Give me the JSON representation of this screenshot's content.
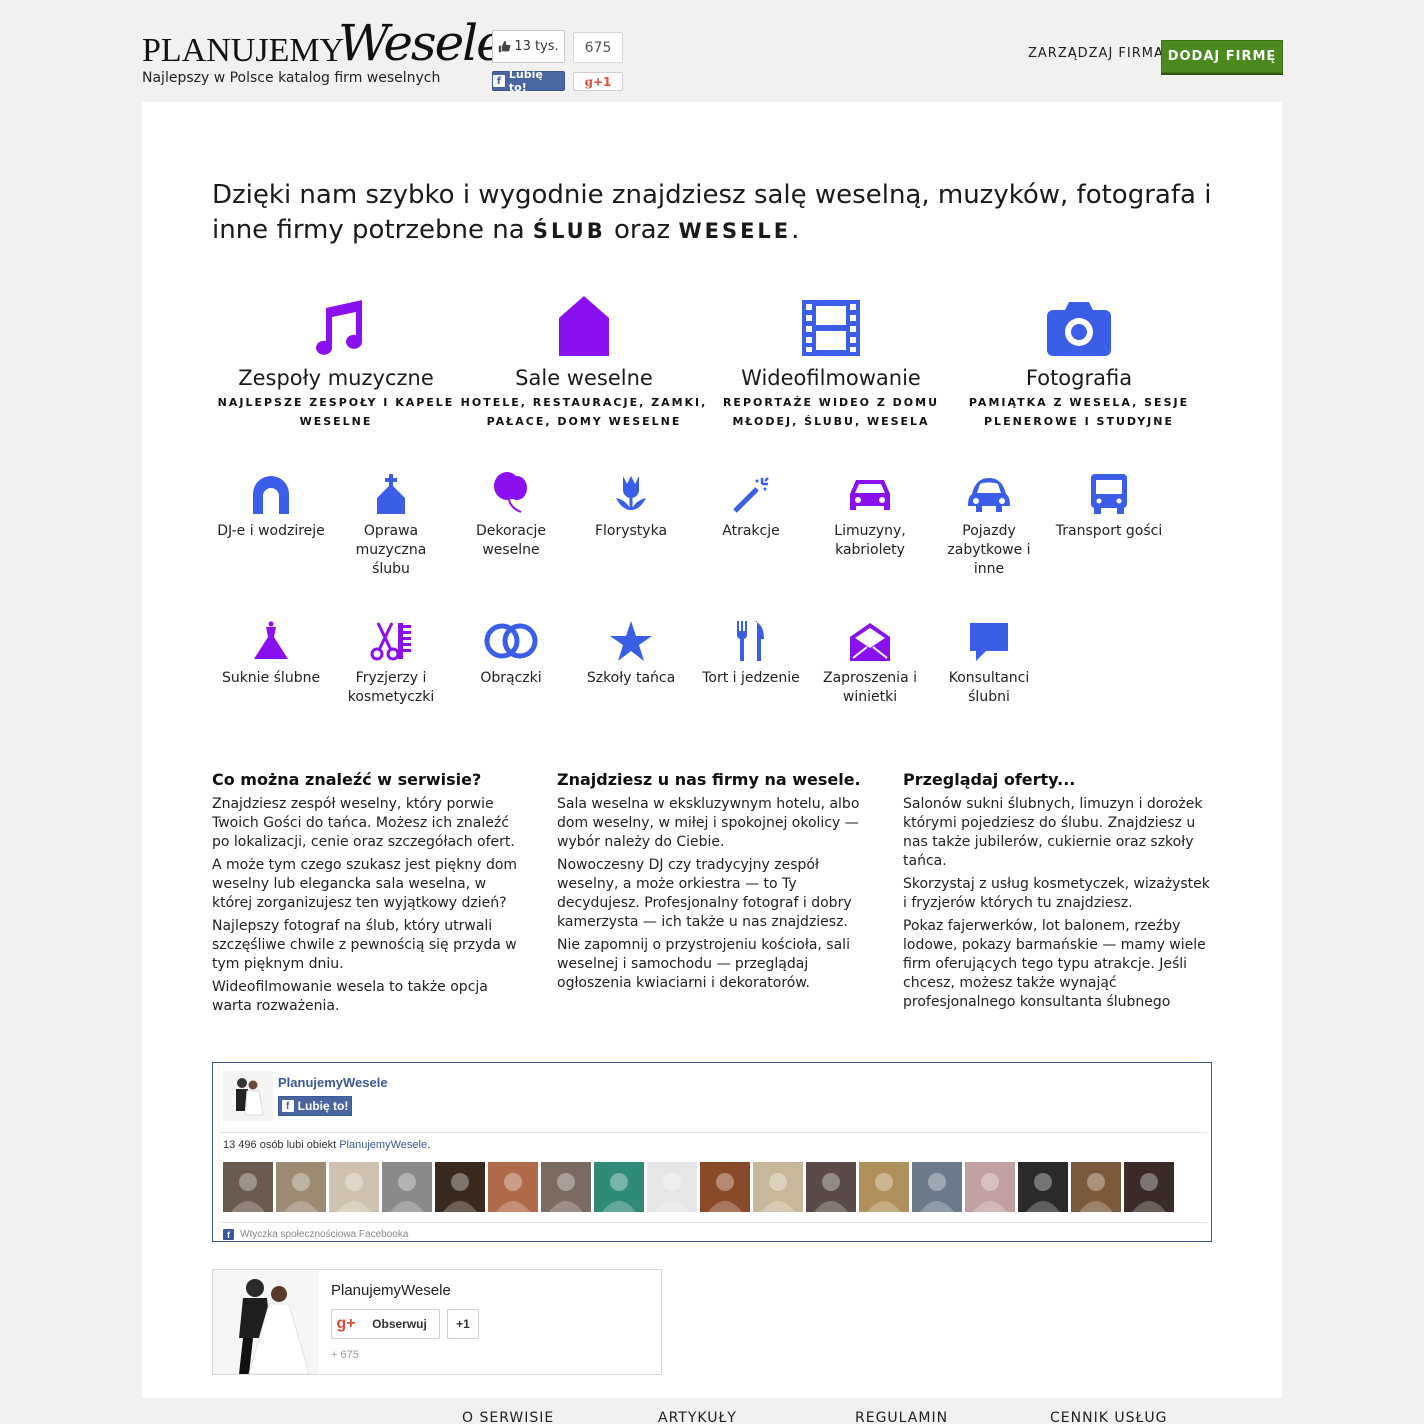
{
  "header": {
    "logo_part1": "PLANUJEMY",
    "logo_part2": "Wesele",
    "tagline": "Najlepszy w Polsce katalog firm weselnych",
    "fb_count": "13 tys.",
    "fb_like_label": "Lubię to!",
    "gplus_count": "675",
    "gplus_label": "+1",
    "manage_link": "ZARZĄDZAJ FIRMĄ",
    "add_button": "DODAJ FIRMĘ"
  },
  "intro": {
    "text_before": "Dzięki nam szybko i wygodnie znajdziesz salę weselną, muzyków, fotografa i inne firmy potrzebne na",
    "bold1": "ŚLUB",
    "middle": "oraz",
    "bold2": "WESELE",
    "end": "."
  },
  "big_categories": [
    {
      "title": "Zespoły muzyczne",
      "subtitle": "NAJLEPSZE ZESPOŁY I KAPELE WESELNE",
      "icon": "music-note-icon",
      "color": "#8b10f0"
    },
    {
      "title": "Sale weselne",
      "subtitle": "HOTELE, RESTAURACJE, ZAMKI, PAŁACE, DOMY WESELNE",
      "icon": "house-icon",
      "color": "#8b10f0"
    },
    {
      "title": "Wideofilmowanie",
      "subtitle": "REPORTAŻE WIDEO Z DOMU MŁODEJ, ŚLUBU, WESELA",
      "icon": "film-icon",
      "color": "#3a5ee8"
    },
    {
      "title": "Fotografia",
      "subtitle": "PAMIĄTKA Z WESELA, SESJE PLENEROWE I STUDYJNE",
      "icon": "camera-icon",
      "color": "#3a5ee8"
    }
  ],
  "small_categories_row1": [
    {
      "label": "DJ-e i wodzireje",
      "icon": "headphones-icon",
      "color": "#3a5ee8"
    },
    {
      "label": "Oprawa muzyczna ślubu",
      "icon": "church-icon",
      "color": "#3a5ee8"
    },
    {
      "label": "Dekoracje weselne",
      "icon": "balloon-icon",
      "color": "#8b10f0"
    },
    {
      "label": "Florystyka",
      "icon": "tulip-icon",
      "color": "#3a5ee8"
    },
    {
      "label": "Atrakcje",
      "icon": "magic-wand-icon",
      "color": "#3a5ee8"
    },
    {
      "label": "Limuzyny, kabriolety",
      "icon": "car-icon",
      "color": "#8b10f0"
    },
    {
      "label": "Pojazdy zabytkowe i inne",
      "icon": "beetle-car-icon",
      "color": "#3a5ee8"
    },
    {
      "label": "Transport gości",
      "icon": "bus-icon",
      "color": "#3a5ee8"
    }
  ],
  "small_categories_row2": [
    {
      "label": "Suknie ślubne",
      "icon": "dress-icon",
      "color": "#8b10f0"
    },
    {
      "label": "Fryzjerzy i kosmetyczki",
      "icon": "scissors-comb-icon",
      "color": "#8b10f0"
    },
    {
      "label": "Obrączki",
      "icon": "rings-icon",
      "color": "#3a5ee8"
    },
    {
      "label": "Szkoły tańca",
      "icon": "star-icon",
      "color": "#3a5ee8"
    },
    {
      "label": "Tort i jedzenie",
      "icon": "fork-knife-icon",
      "color": "#3a5ee8"
    },
    {
      "label": "Zaproszenia i winietki",
      "icon": "envelope-icon",
      "color": "#8b10f0"
    },
    {
      "label": "Konsultanci ślubni",
      "icon": "speech-bubble-icon",
      "color": "#3a5ee8"
    }
  ],
  "columns": [
    {
      "heading": "Co można znaleźć w serwisie?",
      "paragraphs": [
        "Znajdziesz zespół weselny, który porwie Twoich Gości do tańca. Możesz ich znaleźć po lokalizacji, cenie oraz szczegółach ofert.",
        "A może tym czego szukasz jest piękny dom weselny lub elegancka sala weselna, w której zorganizujesz ten wyjątkowy dzień?",
        "Najlepszy fotograf na ślub, który utrwali szczęśliwe chwile z pewnością się przyda w tym pięknym dniu.",
        "Wideofilmowanie wesela to także opcja warta rozważenia."
      ]
    },
    {
      "heading": "Znajdziesz u nas firmy na wesele.",
      "paragraphs": [
        "Sala weselna w ekskluzywnym hotelu, albo dom weselny, w miłej i spokojnej okolicy — wybór należy do Ciebie.",
        "Nowoczesny DJ czy tradycyjny zespół weselny, a może orkiestra — to Ty decydujesz. Profesjonalny fotograf i dobry kamerzysta — ich także u nas znajdziesz.",
        "Nie zapomnij o przystrojeniu kościoła, sali weselnej i samochodu — przeglądaj ogłoszenia kwiaciarni i dekoratorów."
      ]
    },
    {
      "heading": "Przeglądaj oferty...",
      "paragraphs": [
        "Salonów sukni ślubnych, limuzyn i dorożek którymi pojedziesz do ślubu. Znajdziesz u nas także jubilerów, cukiernie oraz szkoły tańca.",
        "Skorzystaj z usług kosmetyczek, wizażystek i fryzjerów których tu znajdziesz.",
        "Pokaz fajerwerków, lot balonem, rzeźby lodowe, pokazy barmańskie — mamy wiele firm oferujących tego typu atrakcje. Jeśli chcesz, możesz także wynająć profesjonalnego konsultanta ślubnego"
      ]
    }
  ],
  "fb_widget": {
    "page_name": "PlanujemyWesele",
    "like_label": "Lubię to!",
    "likes_text": "13 496 osób lubi obiekt",
    "likes_link": "PlanujemyWesele",
    "likes_end": ".",
    "footer": "Wtyczka społecznościowa Facebooka",
    "face_colors": [
      "#6b5a4e",
      "#9c8a72",
      "#cfc2b0",
      "#8a8a8a",
      "#3a2a1e",
      "#b06a4a",
      "#7a6a60",
      "#2f8a78",
      "#e6e6e8",
      "#8a4a2a",
      "#c8b89a",
      "#5a4a48",
      "#b0905a",
      "#6a7a8a",
      "#c0a0a0",
      "#2a2a2a",
      "#7a5a3a",
      "#3a2a28"
    ]
  },
  "gp_widget": {
    "name": "PlanujemyWesele",
    "follow_label": "Obserwuj",
    "plus_label": "+1",
    "count": "+ 675"
  },
  "footer_nav": [
    "O SERWISIE",
    "ARTYKUŁY",
    "REGULAMIN",
    "CENNIK USŁUG"
  ]
}
